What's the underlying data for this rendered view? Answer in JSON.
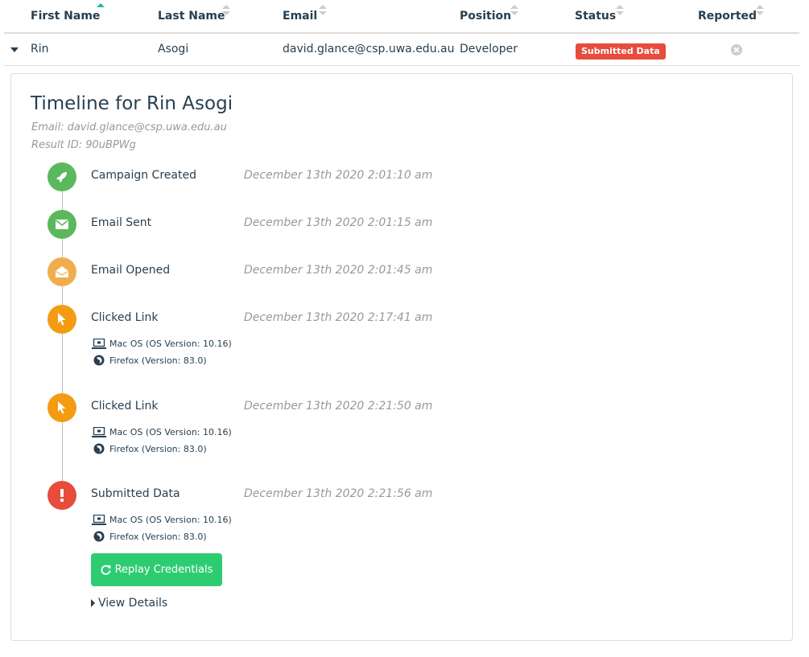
{
  "table": {
    "headers": {
      "first_name": "First Name",
      "last_name": "Last Name",
      "email": "Email",
      "position": "Position",
      "status": "Status",
      "reported": "Reported"
    },
    "sort_column": "first_name",
    "sort_direction": "ascending",
    "row": {
      "first_name": "Rin",
      "last_name": "Asogi",
      "email": "david.glance@csp.uwa.edu.au",
      "position": "Developer",
      "status": "Submitted Data",
      "status_color": "#e74c3c",
      "reported_icon": "times-circle-icon"
    }
  },
  "timeline": {
    "title": "Timeline for Rin Asogi",
    "email_line": "Email: david.glance@csp.uwa.edu.au",
    "result_line": "Result ID: 90uBPWg",
    "events": [
      {
        "name": "Campaign Created",
        "time": "December 13th 2020 2:01:10 am",
        "icon": "rocket-icon",
        "color": "#5cb85c"
      },
      {
        "name": "Email Sent",
        "time": "December 13th 2020 2:01:15 am",
        "icon": "envelope-icon",
        "color": "#5cb85c"
      },
      {
        "name": "Email Opened",
        "time": "December 13th 2020 2:01:45 am",
        "icon": "envelope-open-icon",
        "color": "#f0ad4e"
      },
      {
        "name": "Clicked Link",
        "time": "December 13th 2020 2:17:41 am",
        "icon": "mouse-pointer-icon",
        "color": "#f39c12",
        "os": "Mac OS (OS Version: 10.16)",
        "browser": "Firefox (Version: 83.0)"
      },
      {
        "name": "Clicked Link",
        "time": "December 13th 2020 2:21:50 am",
        "icon": "mouse-pointer-icon",
        "color": "#f39c12",
        "os": "Mac OS (OS Version: 10.16)",
        "browser": "Firefox (Version: 83.0)"
      },
      {
        "name": "Submitted Data",
        "time": "December 13th 2020 2:21:56 am",
        "icon": "exclamation-icon",
        "color": "#e74c3c",
        "os": "Mac OS (OS Version: 10.16)",
        "browser": "Firefox (Version: 83.0)"
      }
    ],
    "replay_button": "Replay Credentials",
    "view_details": "View Details"
  },
  "colors": {
    "text": "#283f50",
    "muted": "#999999",
    "success": "#2ecc71",
    "danger": "#e74c3c",
    "sort_active": "#1abc9c"
  }
}
